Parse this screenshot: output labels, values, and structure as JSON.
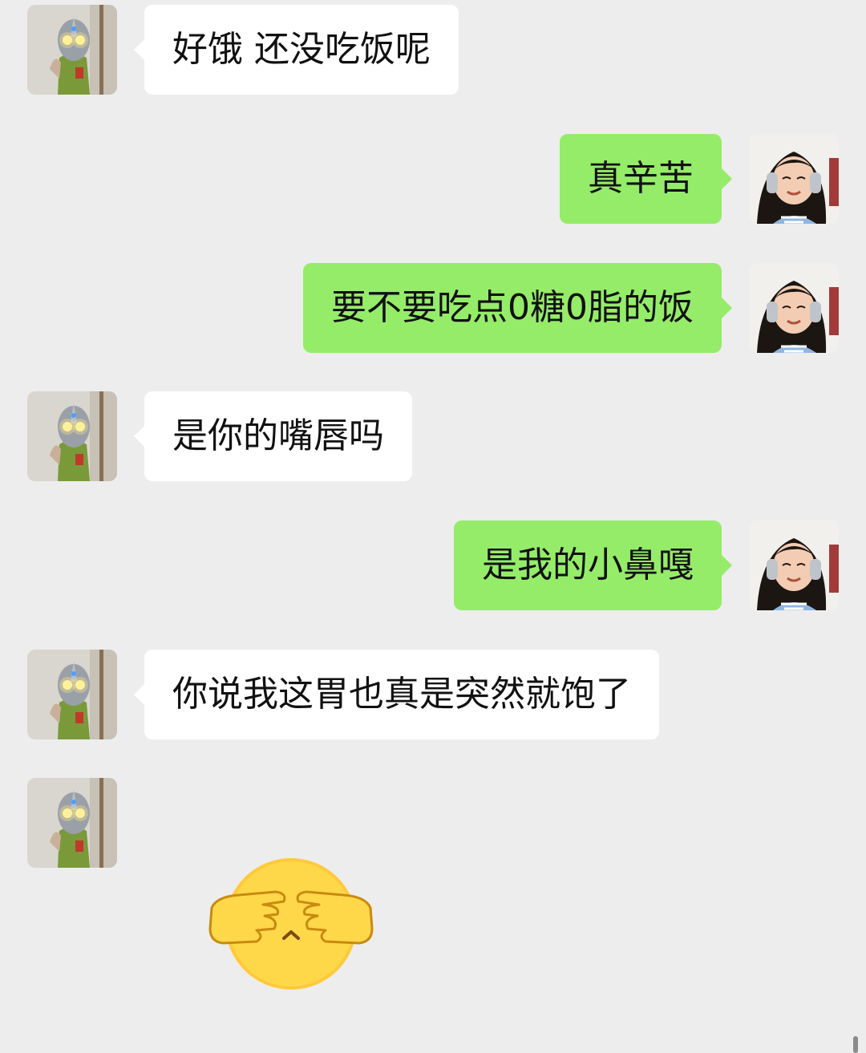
{
  "chat": {
    "messages": [
      {
        "sender": "contact",
        "text": "好饿 还没吃饭呢"
      },
      {
        "sender": "me",
        "text": "真辛苦"
      },
      {
        "sender": "me",
        "text": "要不要吃点0糖0脂的饭"
      },
      {
        "sender": "contact",
        "text": "是你的嘴唇吗"
      },
      {
        "sender": "me",
        "text": "是我的小鼻嘎"
      },
      {
        "sender": "contact",
        "text": "你说我这胃也真是突然就饱了"
      },
      {
        "sender": "contact",
        "sticker": "covering-eyes-emoji"
      }
    ]
  },
  "avatars": {
    "contact": "ultraman-figure-avatar",
    "me": "girl-with-headphones-avatar"
  },
  "colors": {
    "background": "#ededed",
    "incoming_bubble": "#ffffff",
    "outgoing_bubble": "#95ec69",
    "text": "#111111",
    "sticker_face": "#ffd23f"
  }
}
